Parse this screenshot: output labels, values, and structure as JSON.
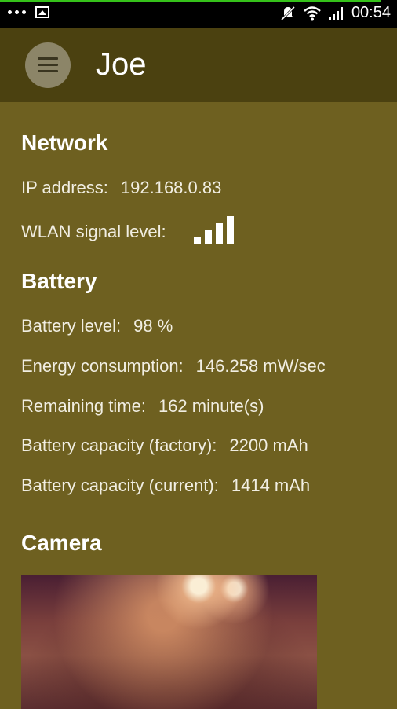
{
  "status_bar": {
    "time": "00:54",
    "progress_fraction": 0.96,
    "icons": [
      "more-dots-icon",
      "image-icon",
      "mute-icon",
      "wifi-icon",
      "cell-signal-icon",
      "battery-icon"
    ]
  },
  "app_bar": {
    "title": "Joe",
    "menu_icon": "hamburger-menu-icon"
  },
  "network": {
    "title": "Network",
    "ip_label": "IP address:",
    "ip_value": "192.168.0.83",
    "wlan_label": "WLAN signal level:",
    "wlan_level_bars": 4,
    "wlan_max_bars": 4
  },
  "battery": {
    "title": "Battery",
    "level_label": "Battery level:",
    "level_value": "98 %",
    "energy_label": "Energy consumption:",
    "energy_value": "146.258 mW/sec",
    "remaining_label": "Remaining time:",
    "remaining_value": "162 minute(s)",
    "cap_factory_label": "Battery capacity (factory):",
    "cap_factory_value": "2200 mAh",
    "cap_current_label": "Battery capacity (current):",
    "cap_current_value": "1414 mAh"
  },
  "camera": {
    "title": "Camera"
  },
  "colors": {
    "background": "#6e6020",
    "app_bar": "#4b4110",
    "status_bar": "#000000",
    "progress": "#35c21a"
  }
}
